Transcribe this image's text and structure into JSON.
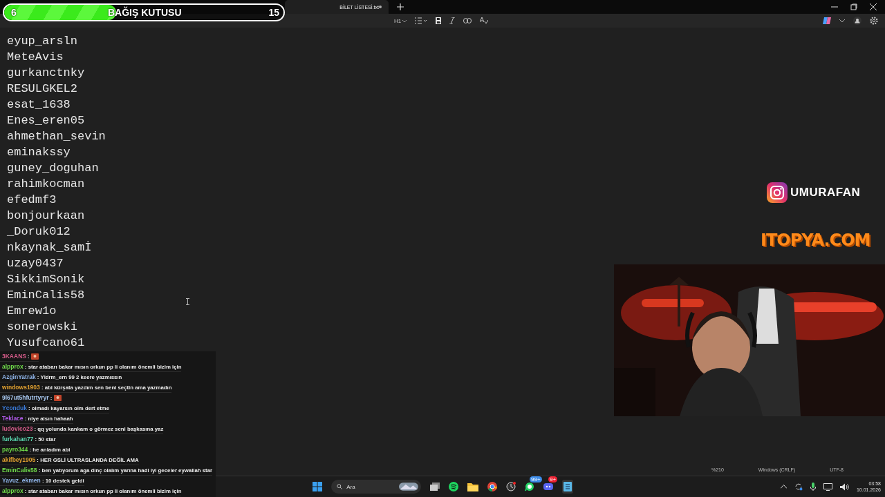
{
  "donation_bar": {
    "current": "6",
    "title": "BAĞIŞ KUTUSU",
    "goal": "15",
    "level": 0.4
  },
  "tabs": [
    {
      "label": "BİLET LİSTESİ.txt",
      "selected": true
    }
  ],
  "toolbar": {
    "heading": "H1"
  },
  "editor_lines": [
    "eyup_arsln",
    "MeteAvis",
    "gurkanctnky",
    "RESULGKEL2",
    "esat_1638",
    "Enes_eren05",
    "ahmethan_sevin",
    "eminakssy",
    "guney_doguhan",
    "rahimkocman",
    "efedmf3",
    "bonjourkaan",
    "_Doruk012",
    "nkaynak_samİ",
    "uzay0437",
    "SikkimSonik",
    "EminCalis58",
    "Emrew1o",
    "sonerowski",
    "Yusufcano61"
  ],
  "instagram": {
    "handle": "UMURAFAN"
  },
  "sponsor": {
    "logo": "ITOPYA.COM"
  },
  "chat": [
    {
      "user": "3KAANS",
      "color": "#d65c8a",
      "kind": "emote",
      "text": ":"
    },
    {
      "user": "alpprox",
      "color": "#6fd94a",
      "kind": "text",
      "text": ": star atabarı bakar mısın orkun pp li olanım önemli bizim için"
    },
    {
      "user": "AzginYatrak",
      "color": "#8fb4e8",
      "kind": "text",
      "text": ": Yldrm_ern 99 2 keere yazmıssın"
    },
    {
      "user": "windows1903",
      "color": "#e0a030",
      "kind": "text",
      "text": ": abi kürşata yazdım sen beni seçtin ama yazmadın"
    },
    {
      "user": "9l67ut5hfutrtyryr",
      "color": "#a8c8f0",
      "kind": "emote",
      "text": ":"
    },
    {
      "user": "Yconduk",
      "color": "#3a7ad8",
      "kind": "text",
      "text": ": olmadı kayarsın olm dert etme"
    },
    {
      "user": "Teklace",
      "color": "#b05ae8",
      "kind": "text",
      "text": ": niye alsın hahaah"
    },
    {
      "user": "ludovico23",
      "color": "#d65c8a",
      "kind": "text",
      "text": ": qq yolunda kankam o görmez seni başkasına yaz"
    },
    {
      "user": "furkahan77",
      "color": "#5ad8b0",
      "kind": "text",
      "text": ": 50 star"
    },
    {
      "user": "payro344",
      "color": "#6fd94a",
      "kind": "text",
      "text": ": he anladım abi"
    },
    {
      "user": "akifbey1905",
      "color": "#e0a030",
      "kind": "text",
      "text": ": HER GSLİ ULTRASLANDA DEĞİL AMA"
    },
    {
      "user": "EminCalis58",
      "color": "#6fd94a",
      "kind": "text",
      "text": ": ben yatıyorum aga dinç olalım yarına hadi iyi geceler eywallah star"
    },
    {
      "user": "Yavuz_ekmen",
      "color": "#8fb4e8",
      "kind": "text",
      "text": ": 10 destek geldi"
    },
    {
      "user": "alpprox",
      "color": "#6fd94a",
      "kind": "text",
      "text": ": star atabarı bakar mısın orkun pp li olanım önemli bizim için"
    }
  ],
  "status_bar": [
    "%210",
    "Windows (CRLF)",
    "UTF-8"
  ],
  "taskbar": {
    "search_placeholder": "Ara",
    "whatsapp_badge": "99+",
    "discord_badge": "9+",
    "time": "03:58",
    "date": "10.01.2026"
  }
}
